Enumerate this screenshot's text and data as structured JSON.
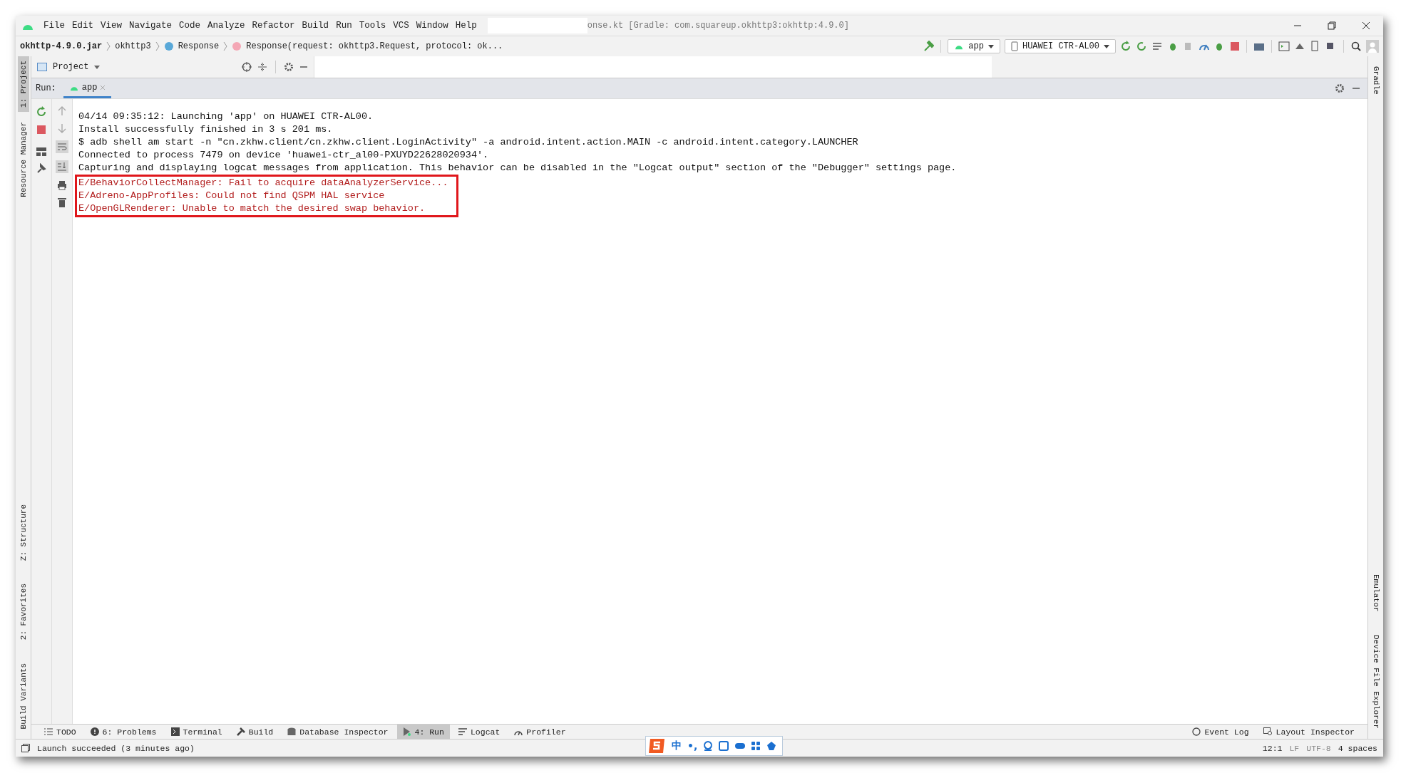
{
  "menu": [
    "File",
    "Edit",
    "View",
    "Navigate",
    "Code",
    "Analyze",
    "Refactor",
    "Build",
    "Run",
    "Tools",
    "VCS",
    "Window",
    "Help"
  ],
  "window": {
    "title": "onse.kt [Gradle: com.squareup.okhttp3:okhttp:4.9.0]"
  },
  "breadcrumbs": [
    {
      "label": "okhttp-4.9.0.jar",
      "kind": "jar"
    },
    {
      "label": "okhttp3",
      "kind": "package"
    },
    {
      "label": "Response",
      "kind": "class"
    },
    {
      "label": "Response(request: okhttp3.Request, protocol: ok...",
      "kind": "method"
    }
  ],
  "run_config": "app",
  "device": "HUAWEI CTR-AL00",
  "left_strip": [
    {
      "label": "1: Project",
      "selected": true
    },
    {
      "label": "Resource Manager",
      "selected": false
    },
    {
      "label": "Z: Structure",
      "selected": false
    },
    {
      "label": "2: Favorites",
      "selected": false
    },
    {
      "label": "Build Variants",
      "selected": false
    }
  ],
  "right_strip": [
    {
      "label": "Gradle"
    },
    {
      "label": "Emulator"
    },
    {
      "label": "Device File Explorer"
    }
  ],
  "project_panel": {
    "title": "Project"
  },
  "run_panel": {
    "label": "Run:",
    "tabs": [
      {
        "label": "app",
        "selected": true
      }
    ]
  },
  "console": {
    "lines": [
      {
        "text": "04/14 09:35:12: Launching 'app' on HUAWEI CTR-AL00.",
        "kind": "info",
        "highlighted": false
      },
      {
        "text": "Install successfully finished in 3 s 201 ms.",
        "kind": "info",
        "highlighted": false
      },
      {
        "text": "$ adb shell am start -n \"cn.zkhw.client/cn.zkhw.client.LoginActivity\" -a android.intent.action.MAIN -c android.intent.category.LAUNCHER",
        "kind": "info",
        "highlighted": false
      },
      {
        "text": "Connected to process 7479 on device 'huawei-ctr_al00-PXUYD22628020934'.",
        "kind": "info",
        "highlighted": false
      },
      {
        "text": "Capturing and displaying logcat messages from application. This behavior can be disabled in the \"Logcat output\" section of the \"Debugger\" settings page.",
        "kind": "info",
        "highlighted": false
      },
      {
        "text": "E/BehaviorCollectManager: Fail to acquire dataAnalyzerService...",
        "kind": "error",
        "highlighted": true
      },
      {
        "text": "E/Adreno-AppProfiles: Could not find QSPM HAL service",
        "kind": "error",
        "highlighted": true
      },
      {
        "text": "E/OpenGLRenderer: Unable to match the desired swap behavior.",
        "kind": "error",
        "highlighted": true
      }
    ]
  },
  "bottom_tabs": [
    {
      "label": "TODO",
      "kind": "todo",
      "selected": false
    },
    {
      "label": "6: Problems",
      "kind": "problems",
      "selected": false
    },
    {
      "label": "Terminal",
      "kind": "terminal",
      "selected": false
    },
    {
      "label": "Build",
      "kind": "build",
      "selected": false
    },
    {
      "label": "Database Inspector",
      "kind": "database",
      "selected": false
    },
    {
      "label": "4: Run",
      "kind": "run",
      "selected": true
    },
    {
      "label": "Logcat",
      "kind": "logcat",
      "selected": false
    },
    {
      "label": "Profiler",
      "kind": "profiler",
      "selected": false
    }
  ],
  "bottom_right_tabs": [
    {
      "label": "Event Log",
      "kind": "event"
    },
    {
      "label": "Layout Inspector",
      "kind": "layout"
    }
  ],
  "status_bar": {
    "message": "Launch succeeded (3 minutes ago)",
    "items": [
      "12:1",
      "LF",
      "UTF-8",
      "4 spaces"
    ]
  },
  "ime_toolbar": {
    "mode": "中",
    "punct": "•,"
  }
}
